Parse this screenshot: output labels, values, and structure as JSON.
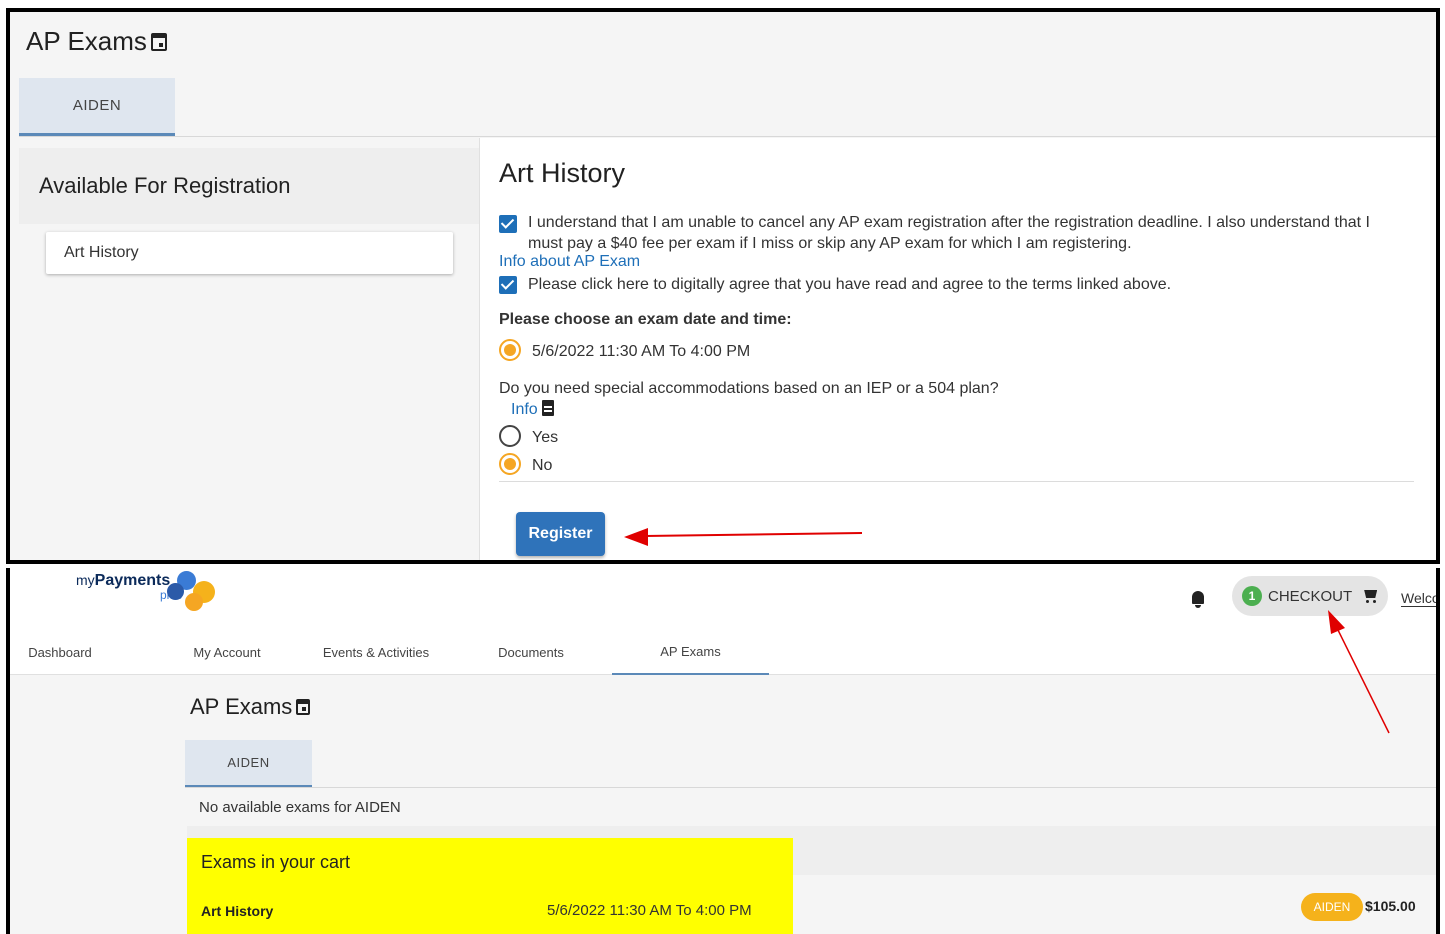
{
  "top_panel": {
    "page_title": "AP Exams",
    "student_tab": "AIDEN",
    "left_heading": "Available For Registration",
    "exam_list": [
      "Art History"
    ],
    "exam_title": "Art History",
    "agreement_line1": "I understand that I am unable to cancel any AP exam registration after the registration deadline.  I also understand that I",
    "agreement_line2": "must pay a $40 fee per exam if I miss or skip any AP exam for which I am registering.",
    "info_link": "Info about AP Exam",
    "digital_agree": "Please click here to digitally agree that you have read and agree to the terms linked above.",
    "date_prompt": "Please choose an exam date and time:",
    "date_option": "5/6/2022 11:30 AM To 4:00 PM",
    "accommodation_question": "Do you need special accommodations based on an IEP or a 504 plan?",
    "info_label": "Info",
    "option_yes": "Yes",
    "option_no": "No",
    "register_label": "Register"
  },
  "bottom_panel": {
    "logo_my": "my",
    "logo_payments": "Payments",
    "logo_plus": "plus",
    "checkout_count": "1",
    "checkout_label": "CHECKOUT",
    "welcome_text": "Welcome",
    "nav": [
      {
        "label": "Dashboard"
      },
      {
        "label": "My Account"
      },
      {
        "label": "Events & Activities"
      },
      {
        "label": "Documents"
      },
      {
        "label": "AP Exams"
      }
    ],
    "page_title": "AP Exams",
    "student_tab": "AIDEN",
    "no_exams_text": "No available exams for AIDEN",
    "cart_heading": "Exams in your cart",
    "cart_items": [
      {
        "name": "Art History",
        "date": "5/6/2022 11:30 AM To 4:00 PM",
        "student": "AIDEN",
        "price": "$105.00"
      }
    ]
  },
  "colors": {
    "accent_blue": "#1e6fb8",
    "radio_selected": "#f5a623",
    "highlight": "#ffff00",
    "annotation_arrow": "#e00000",
    "checkout_badge": "#4caf50"
  }
}
